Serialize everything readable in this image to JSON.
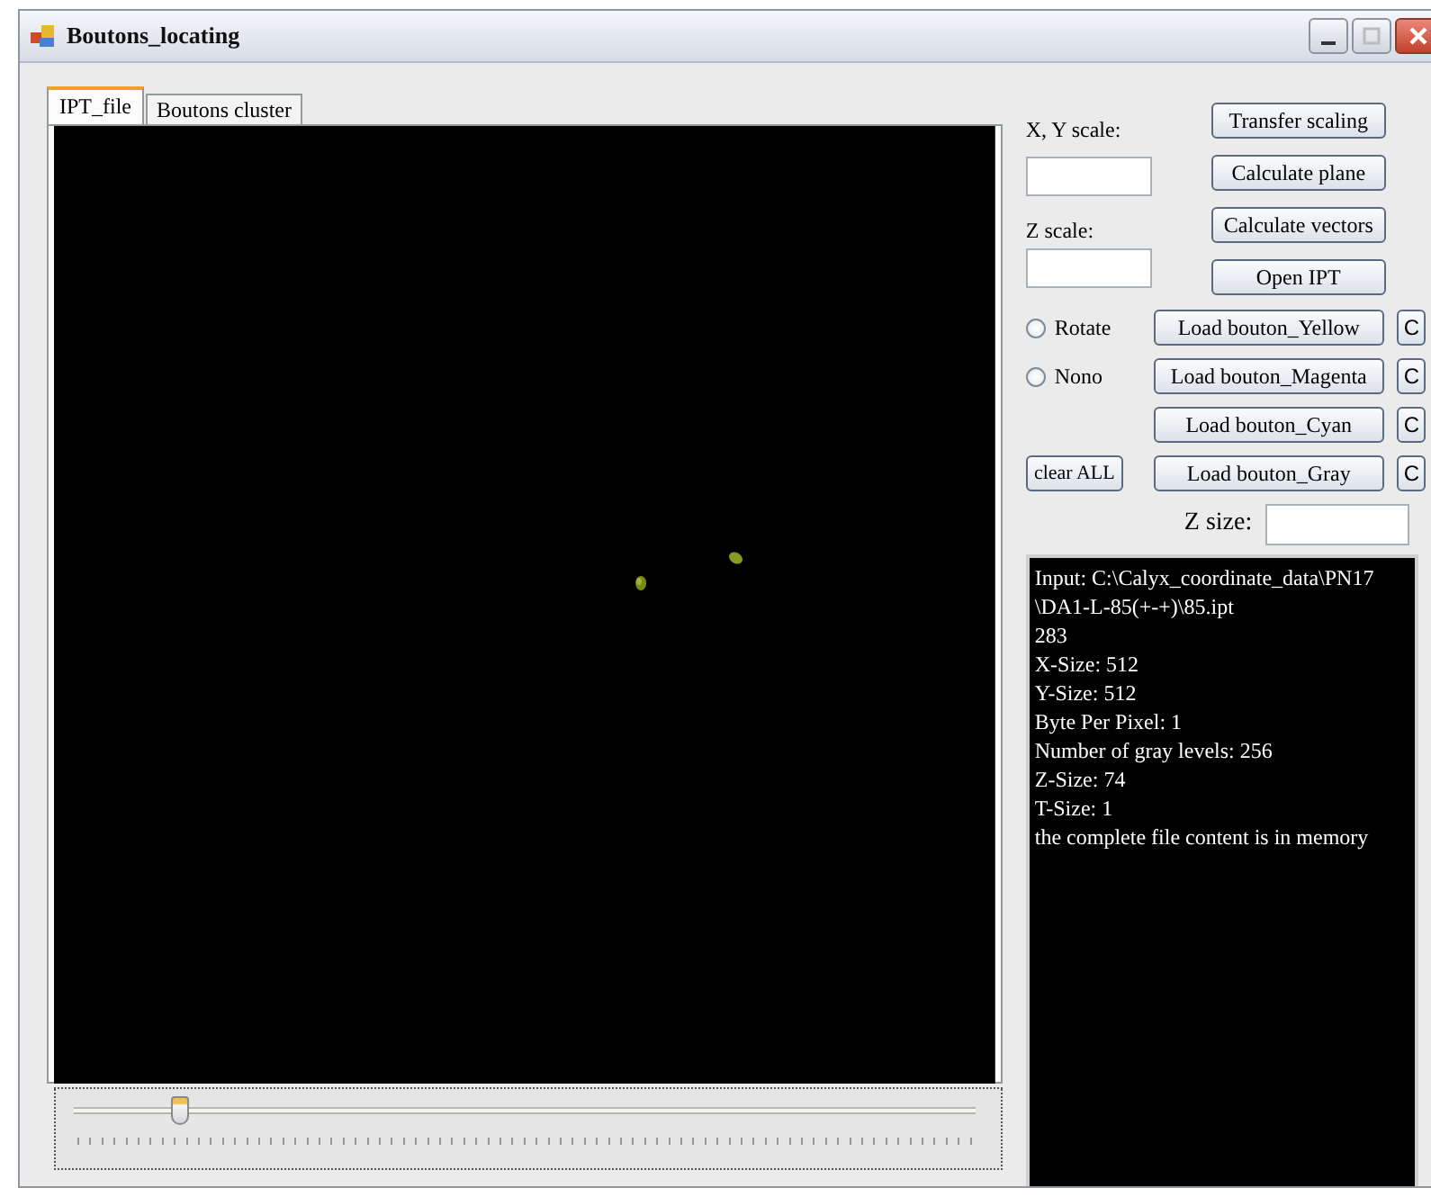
{
  "window": {
    "title": "Boutons_locating"
  },
  "tabs": [
    {
      "label": "IPT_file",
      "selected": true
    },
    {
      "label": "Boutons cluster",
      "selected": false
    }
  ],
  "slider": {
    "level": 0.11
  },
  "scale_fields": [
    {
      "label": "X, Y scale:"
    },
    {
      "label": "Z scale:"
    }
  ],
  "action_buttons": [
    "Transfer scaling",
    "Calculate plane",
    "Calculate vectors",
    "Open IPT"
  ],
  "load_rows": [
    {
      "left": {
        "kind": "radio",
        "label": "Rotate",
        "selected": false
      },
      "label": "Load bouton_Yellow",
      "side_button": "C"
    },
    {
      "left": {
        "kind": "radio",
        "label": "Nono",
        "selected": false
      },
      "label": "Load bouton_Magenta",
      "side_button": "C"
    },
    {
      "label": "Load bouton_Cyan",
      "side_button": "C"
    },
    {
      "left": {
        "kind": "button",
        "label": "clear ALL"
      },
      "label": "Load bouton_Gray",
      "side_button": "C"
    }
  ],
  "z_size": {
    "label": "Z size:"
  },
  "console": {
    "lines": [
      "Input: C:\\Calyx_coordinate_data\\PN17",
      "\\DA1-L-85(+-+)\\85.ipt",
      "283",
      "X-Size: 512",
      "Y-Size: 512",
      "Byte Per Pixel: 1",
      "Number of gray levels: 256",
      "Z-Size: 74",
      "T-Size: 1",
      "the complete file content is in memory"
    ]
  }
}
